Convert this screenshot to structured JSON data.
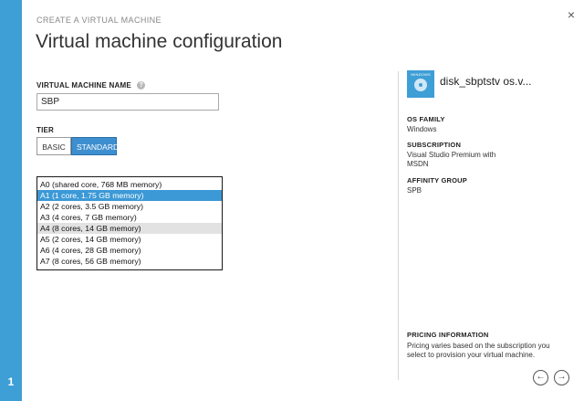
{
  "wizard": {
    "step_number": "1",
    "eyebrow": "CREATE A VIRTUAL MACHINE",
    "title": "Virtual machine configuration",
    "close_glyph": "×"
  },
  "form": {
    "vm_name_label": "VIRTUAL MACHINE NAME",
    "help_glyph": "?",
    "vm_name_value": "SBP",
    "tier_label": "TIER",
    "tiers": [
      {
        "label": "BASIC",
        "selected": false
      },
      {
        "label": "STANDARD",
        "selected": true
      }
    ],
    "sizes": [
      {
        "label": "A0 (shared core, 768 MB memory)",
        "state": ""
      },
      {
        "label": "A1 (1 core, 1.75 GB memory)",
        "state": "selected"
      },
      {
        "label": "A2 (2 cores, 3.5 GB memory)",
        "state": ""
      },
      {
        "label": "A3 (4 cores, 7 GB memory)",
        "state": ""
      },
      {
        "label": "A4 (8 cores, 14 GB memory)",
        "state": "hover"
      },
      {
        "label": "A5 (2 cores, 14 GB memory)",
        "state": ""
      },
      {
        "label": "A6 (4 cores, 28 GB memory)",
        "state": ""
      },
      {
        "label": "A7 (8 cores, 56 GB memory)",
        "state": ""
      }
    ]
  },
  "details": {
    "icon_text": "WINDOWS",
    "disk_name": "disk_sbptstv             os.v...",
    "os_family_label": "OS FAMILY",
    "os_family_value": "Windows",
    "subscription_label": "SUBSCRIPTION",
    "subscription_value": "Visual Studio Premium with MSDN",
    "affinity_label": "AFFINITY GROUP",
    "affinity_value": "SPB",
    "pricing_label": "PRICING INFORMATION",
    "pricing_text": "Pricing varies based on the subscription you select to provision your virtual machine."
  },
  "nav": {
    "back_glyph": "←",
    "next_glyph": "→"
  },
  "colors": {
    "accent": "#3e9ed6",
    "selected_row": "#3c99d6",
    "hover_row": "#e2e2e2"
  }
}
